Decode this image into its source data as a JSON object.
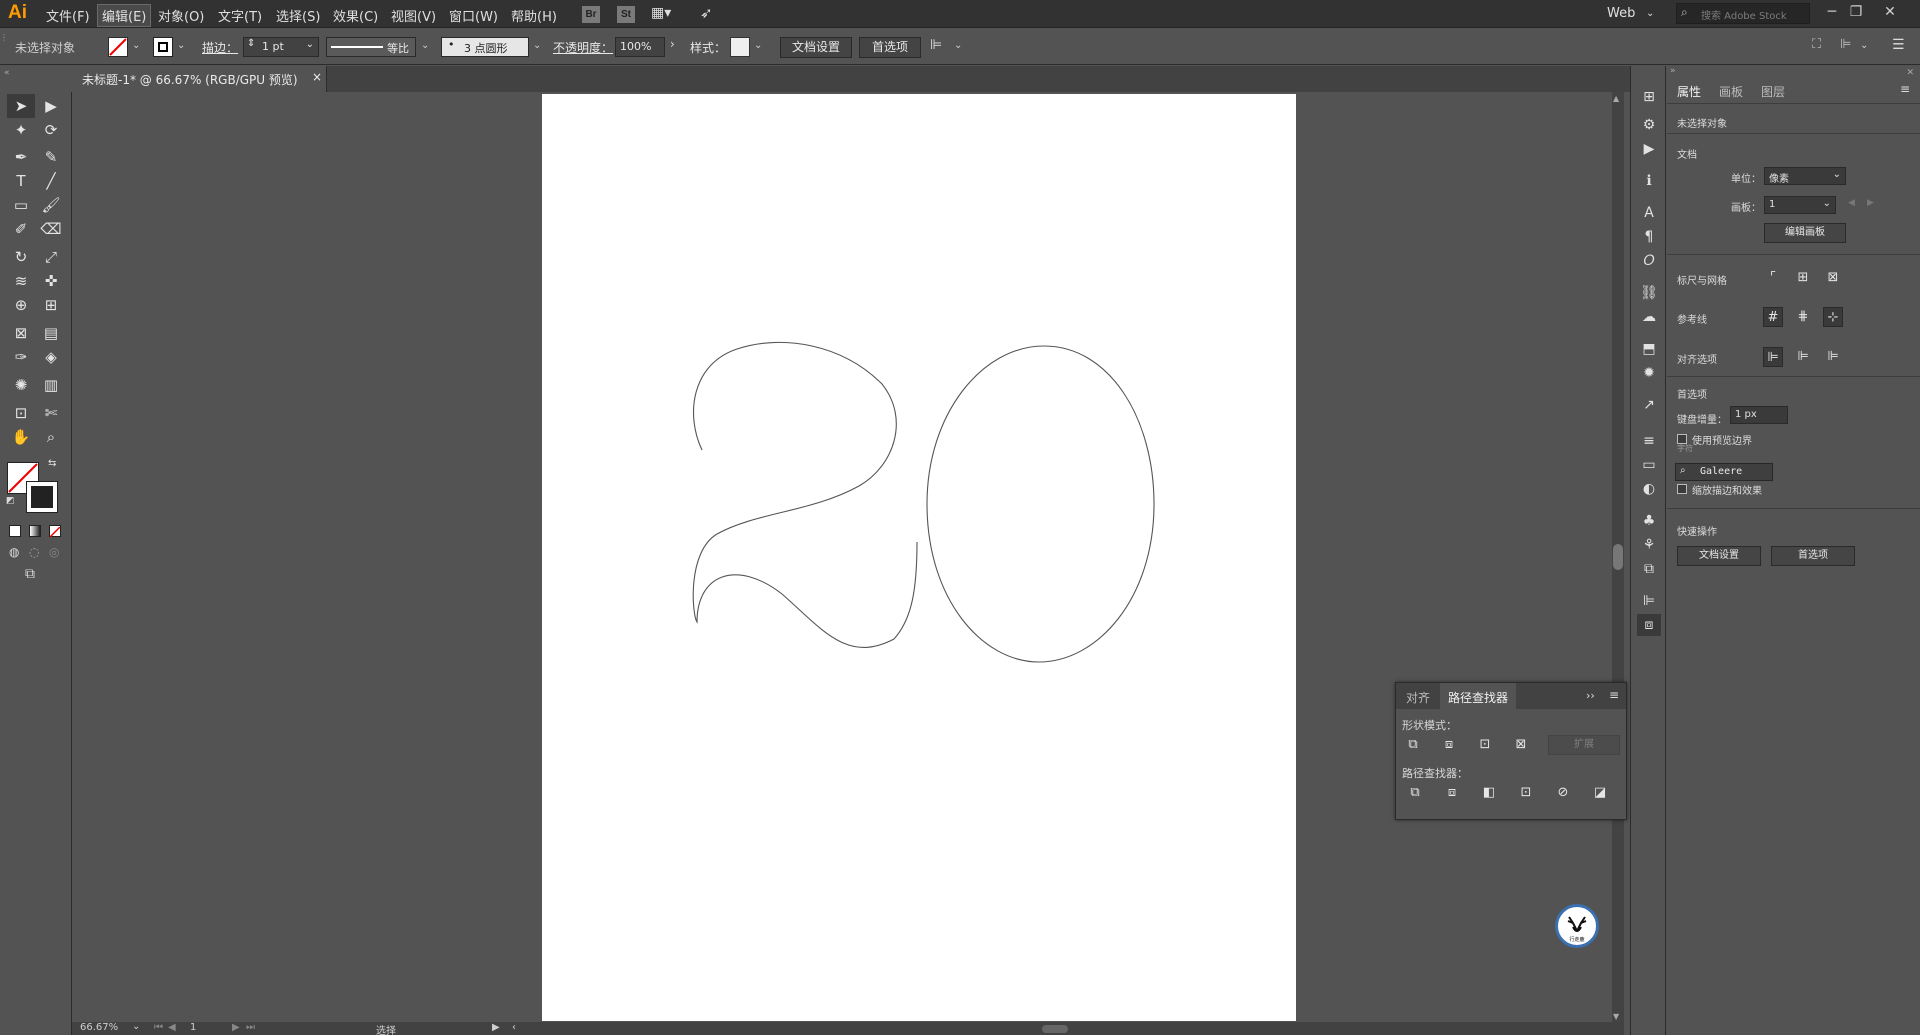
{
  "menubar": {
    "logo": "Ai",
    "items": [
      "文件(F)",
      "编辑(E)",
      "对象(O)",
      "文字(T)",
      "选择(S)",
      "效果(C)",
      "视图(V)",
      "窗口(W)",
      "帮助(H)"
    ],
    "badges": [
      "Br",
      "St"
    ],
    "workspace": "Web",
    "search_placeholder": "搜索 Adobe Stock"
  },
  "controlbar": {
    "no_selection": "未选择对象",
    "stroke_label": "描边：",
    "stroke_value": "1 pt",
    "stroke_profile": "等比",
    "brush": "3 点圆形",
    "opacity_label": "不透明度：",
    "opacity_value": "100%",
    "style_label": "样式：",
    "doc_setup": "文档设置",
    "prefs": "首选项"
  },
  "tab": {
    "title": "未标题-1* @ 66.67% (RGB/GPU 预览)",
    "close": "×"
  },
  "status": {
    "zoom": "66.67%",
    "artboard": "1",
    "mode": "选择"
  },
  "properties": {
    "tabs": [
      "属性",
      "画板",
      "图层"
    ],
    "no_selection": "未选择对象",
    "document": "文档",
    "unit_label": "单位：",
    "unit_value": "像素",
    "artboard_label": "画板：",
    "artboard_value": "1",
    "edit_artboard": "编辑画板",
    "rulers_grids": "标尺与网格",
    "guides": "参考线",
    "snap_options": "对齐选项",
    "preferences": "首选项",
    "keyboard_increment_label": "键盘增量：",
    "keyboard_increment_value": "1 px",
    "use_preview_bounds": "使用预览边界",
    "tooltip_hint": "字符",
    "font_tooltip": "Galeere",
    "scale_strokes": "缩放描边和效果",
    "quick_actions": "快速操作",
    "qa_doc_setup": "文档设置",
    "qa_prefs": "首选项"
  },
  "pathfinder": {
    "tabs": [
      "对齐",
      "路径查找器"
    ],
    "shape_modes": "形状模式：",
    "expand": "扩展",
    "pathfinders": "路径查找器："
  },
  "watermark_text": "行走鹿",
  "colors": {
    "ui_dark": "#323232",
    "ui_mid": "#535353",
    "artboard": "#ffffff",
    "accent_logo": "#ff9a00",
    "watermark_ring": "#3b6fb0"
  }
}
